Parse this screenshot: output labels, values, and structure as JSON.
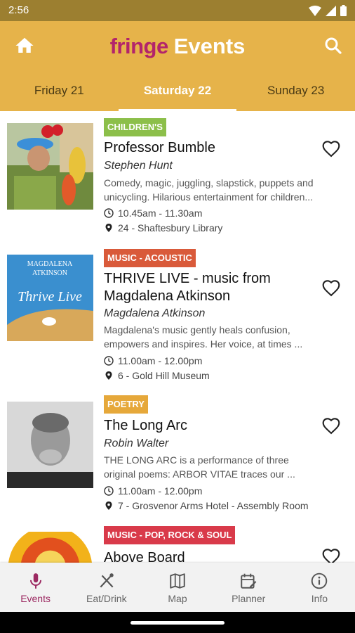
{
  "status_bar": {
    "time": "2:56"
  },
  "app_bar": {
    "brand_fringe": "fringe",
    "brand_events": "Events"
  },
  "day_tabs": [
    {
      "label": "Friday 21"
    },
    {
      "label": "Saturday 22"
    },
    {
      "label": "Sunday 23"
    }
  ],
  "events": [
    {
      "tag": "CHILDREN'S",
      "tag_color": "#8cbf4a",
      "title_lines": [
        "Professor Bumble"
      ],
      "performer": "Stephen Hunt",
      "description": [
        "Comedy, magic, juggling, slapstick, puppets and",
        "unicycling.  Hilarious entertainment for children..."
      ],
      "time": "10.45am - 11.30am",
      "venue": "24 - Shaftesbury Library"
    },
    {
      "tag": "MUSIC - ACOUSTIC",
      "tag_color": "#d95a3a",
      "title_lines": [
        "THRIVE LIVE - music from",
        "Magdalena Atkinson"
      ],
      "performer": "Magdalena Atkinson",
      "description": [
        "Magdalena's music gently heals confusion,",
        "empowers and inspires. Her voice, at times ..."
      ],
      "time": "11.00am - 12.00pm",
      "venue": "6 - Gold Hill Museum",
      "image_text": [
        "MAGDALENA",
        "ATKINSON",
        "Thrive Live"
      ]
    },
    {
      "tag": "POETRY",
      "tag_color": "#e6a83a",
      "title_lines": [
        "The Long Arc"
      ],
      "performer": "Robin Walter",
      "description": [
        "THE LONG ARC is a performance of three",
        "original poems: ARBOR VITAE traces our ..."
      ],
      "time": "11.00am - 12.00pm",
      "venue": "7 - Grosvenor Arms Hotel - Assembly Room"
    },
    {
      "tag": "MUSIC - POP, ROCK & SOUL",
      "tag_color": "#d93a4a",
      "title_lines": [
        "Above Board"
      ]
    }
  ],
  "bottom_nav": [
    {
      "label": "Events",
      "icon": "microphone-icon"
    },
    {
      "label": "Eat/Drink",
      "icon": "utensils-icon"
    },
    {
      "label": "Map",
      "icon": "map-icon"
    },
    {
      "label": "Planner",
      "icon": "planner-icon"
    },
    {
      "label": "Info",
      "icon": "info-icon"
    }
  ],
  "colors": {
    "app_bar": "#e6b34a",
    "status_bar": "#9c7f30",
    "brand_fringe": "#b3246b",
    "nav_active": "#9c2a62"
  }
}
